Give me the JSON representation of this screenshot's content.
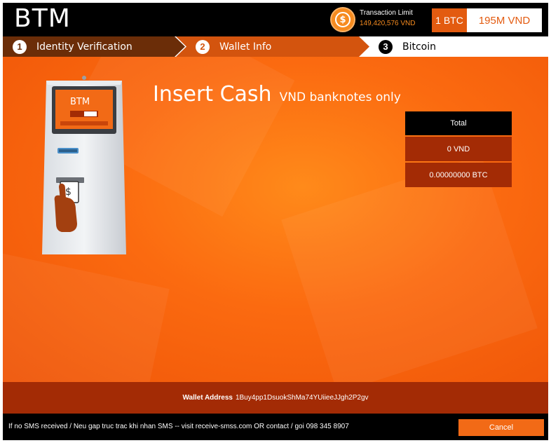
{
  "app": {
    "brand": "BTM"
  },
  "header": {
    "limit_icon_glyph": "$",
    "limit_label": "Transaction Limit",
    "limit_value": "149,420,576 VND",
    "rate_btc": "1 BTC",
    "rate_vnd": "195M VND"
  },
  "steps": [
    {
      "num": "1",
      "label": "Identity Verification",
      "state": "done"
    },
    {
      "num": "2",
      "label": "Wallet Info",
      "state": "done"
    },
    {
      "num": "3",
      "label": "Bitcoin",
      "state": "active"
    }
  ],
  "main": {
    "title": "Insert Cash",
    "subtitle": "VND banknotes only",
    "kiosk_screen_text": "BTM",
    "totals": {
      "header": "Total",
      "vnd": "0 VND",
      "btc": "0.00000000 BTC"
    }
  },
  "wallet": {
    "label": "Wallet Address",
    "address": "1Buy4pp1DsuokShMa74YUiieeJJgh2P2gv"
  },
  "footer": {
    "notice": "If no SMS received / Neu gap truc trac khi nhan SMS -- visit receive-smss.com OR contact / goi 098 345 8907",
    "cancel_label": "Cancel"
  },
  "colors": {
    "accent": "#f26a16",
    "dark_step": "#6b2d08",
    "mid_step": "#d3540e",
    "dark_red": "#a32b05",
    "background_orange": "#fb6a10"
  },
  "icons": {
    "limit": "dollar-circle-icon",
    "kiosk": "atm-kiosk-illustration"
  }
}
